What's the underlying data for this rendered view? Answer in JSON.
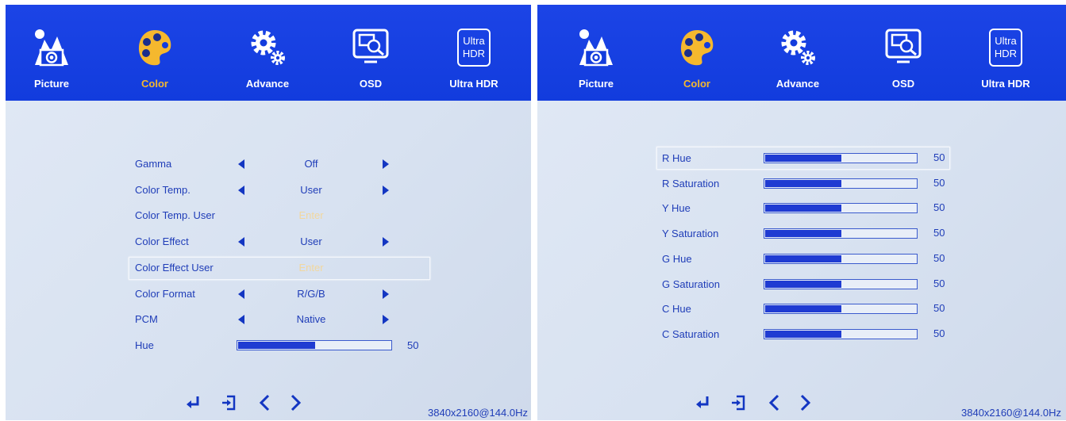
{
  "tabs": [
    {
      "label": "Picture",
      "icon": "picture-icon"
    },
    {
      "label": "Color",
      "icon": "color-palette-icon"
    },
    {
      "label": "Advance",
      "icon": "gears-icon"
    },
    {
      "label": "OSD",
      "icon": "osd-monitor-icon"
    },
    {
      "label": "Ultra HDR",
      "icon": "ultra-hdr-icon",
      "icon_text": [
        "Ultra",
        "HDR"
      ]
    }
  ],
  "active_tab": "Color",
  "left": {
    "items": [
      {
        "label": "Gamma",
        "value": "Off",
        "type": "select"
      },
      {
        "label": "Color Temp.",
        "value": "User",
        "type": "select"
      },
      {
        "label": "Color Temp. User",
        "value": "Enter",
        "type": "enter"
      },
      {
        "label": "Color Effect",
        "value": "User",
        "type": "select"
      },
      {
        "label": "Color Effect User",
        "value": "Enter",
        "type": "enter",
        "selected": true
      },
      {
        "label": "Color Format",
        "value": "R/G/B",
        "type": "select"
      },
      {
        "label": "PCM",
        "value": "Native",
        "type": "select"
      },
      {
        "label": "Hue",
        "value": "50",
        "type": "slider",
        "level": 0.5
      }
    ],
    "resolution": "3840x2160@144.0Hz"
  },
  "right": {
    "items": [
      {
        "label": "R Hue",
        "value": "50",
        "level": 0.5,
        "selected": true
      },
      {
        "label": "R Saturation",
        "value": "50",
        "level": 0.5
      },
      {
        "label": "Y Hue",
        "value": "50",
        "level": 0.5
      },
      {
        "label": "Y Saturation",
        "value": "50",
        "level": 0.5
      },
      {
        "label": "G Hue",
        "value": "50",
        "level": 0.5
      },
      {
        "label": "G Saturation",
        "value": "50",
        "level": 0.5
      },
      {
        "label": "C Hue",
        "value": "50",
        "level": 0.5
      },
      {
        "label": "C Saturation",
        "value": "50",
        "level": 0.5
      }
    ],
    "resolution": "3840x2160@144.0Hz"
  },
  "bottom_icons": [
    "enter-icon",
    "exit-icon",
    "left-chevron-icon",
    "right-chevron-icon"
  ],
  "colors": {
    "topbar": "#1a40e2",
    "active_label": "#f5b82e",
    "text": "#1f3db8",
    "enter_text": "#f2d79e",
    "panel": "#dbe4f2"
  }
}
